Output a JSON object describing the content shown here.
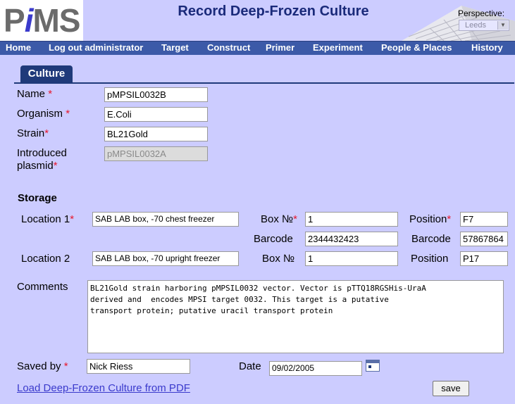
{
  "app": {
    "logo": "PiMS",
    "title": "Record Deep-Frozen Culture",
    "perspective_label": "Perspective:",
    "perspective_value": "Leeds"
  },
  "nav": [
    "Home",
    "Log out administrator",
    "Target",
    "Construct",
    "Primer",
    "Experiment",
    "People & Places",
    "History"
  ],
  "tab": "Culture",
  "form": {
    "name_label": "Name",
    "name_value": "pMPSIL0032B",
    "organism_label": "Organism",
    "organism_value": "E.Coli",
    "strain_label": "Strain",
    "strain_value": "BL21Gold",
    "plasmid_label_1": "Introduced",
    "plasmid_label_2": "plasmid",
    "plasmid_value": "pMPSIL0032A",
    "required_marker": "*"
  },
  "storage": {
    "title": "Storage",
    "location1_label": "Location 1",
    "location1_value": "SAB LAB box, -70 chest freezer",
    "box1_label": "Box №",
    "box1_value": "1",
    "position1_label": "Position",
    "position1_value": "F7",
    "barcode_label": "Barcode",
    "barcode_box_value": "2344432423",
    "barcode_position_value": "57867864",
    "location2_label": "Location 2",
    "location2_value": "SAB LAB box, -70 upright freezer",
    "box2_label": "Box №",
    "box2_value": "1",
    "position2_label": "Position",
    "position2_value": "P17"
  },
  "comments": {
    "label": "Comments",
    "value": "BL21Gold strain harboring pMPSIL0032 vector. Vector is pTTQ18RGSHis-UraA\nderived and  encodes MPSI target 0032. This target is a putative\ntransport protein; putative uracil transport protein"
  },
  "footer": {
    "saved_by_label": "Saved by",
    "saved_by_value": "Nick Riess",
    "date_label": "Date",
    "date_value": "09/02/2005",
    "load_link": "Load Deep-Frozen Culture from PDF",
    "save_button": "save"
  },
  "colors": {
    "background": "#ccccff",
    "navbar": "#3c5aa8",
    "tab": "#1f3a7a",
    "required": "#e8172c",
    "link": "#3a3acc"
  }
}
